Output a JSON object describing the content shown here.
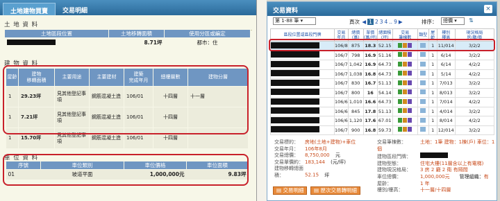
{
  "left_panel": {
    "tabs": [
      "土地建物買賣",
      "交易明細"
    ],
    "land": {
      "title": "土 地 資 料",
      "headers": [
        "土地區段位置",
        "土地移轉面積",
        "使用分區或編定"
      ],
      "row": {
        "area": "8.71坪",
        "zoning": "都市：住"
      }
    },
    "building": {
      "title": "建 物 資 料",
      "headers": [
        "屋齡",
        "建物\n移轉面積",
        "主要用途",
        "主要建材",
        "建築\n完成年月",
        "總樓層數",
        "建物分層"
      ],
      "rows": [
        {
          "age": "1",
          "area": "29.23坪",
          "use": "見其他登記事項",
          "material": "鋼筋混凝土造",
          "completed": "106/01",
          "floors": "十四層",
          "layer": "十一層"
        },
        {
          "age": "1",
          "area": "7.21坪",
          "use": "見其他登記事項",
          "material": "鋼筋混凝土造",
          "completed": "106/01",
          "floors": "十四層",
          "layer": ""
        },
        {
          "age": "1",
          "area": "15.70坪",
          "use": "見其他登記事項",
          "material": "鋼筋混凝土造",
          "completed": "106/01",
          "floors": "十四層",
          "layer": ""
        }
      ]
    },
    "parking": {
      "title": "車 位 資 料",
      "headers": [
        "序號",
        "車位類別",
        "車位價格",
        "車位面積"
      ],
      "row": {
        "no": "01",
        "type": "坡道平面",
        "price": "1,000,000元",
        "area": "9.83坪"
      }
    }
  },
  "right_panel": {
    "title": "交易資料",
    "close": "×",
    "range_select": "第 1-88 筆",
    "pages_label": "頁次",
    "pages": [
      "1",
      "2",
      "3",
      "4",
      "..",
      "9"
    ],
    "sort_label": "排序：",
    "sort_select": "總價",
    "headers": [
      "區段位置或區段門牌",
      "交易\n年月",
      "總價\n(萬)",
      "單價\n(萬/坪)",
      "總面積\n(坪)",
      "交易\n筆棟數",
      "類型",
      "屋齡",
      "樓別\n樓高",
      "現況格局\n房/廳/衛"
    ],
    "rows": [
      {
        "ym": "106/8",
        "total": "875",
        "unit": "18.3",
        "area": "52.15",
        "age": "1",
        "floor": "11/014",
        "layout": "3/2/2"
      },
      {
        "ym": "106/7",
        "total": "798",
        "unit": "16.9",
        "area": "51.16",
        "age": "1",
        "floor": "6/14",
        "layout": "3/2/2"
      },
      {
        "ym": "106/7",
        "total": "1,042",
        "unit": "16.9",
        "area": "64.73",
        "age": "1",
        "floor": "6/14",
        "layout": "4/2/2"
      },
      {
        "ym": "106/7",
        "total": "1,038",
        "unit": "16.8",
        "area": "64.73",
        "age": "1",
        "floor": "5/14",
        "layout": "4/2/2"
      },
      {
        "ym": "106/7",
        "total": "830",
        "unit": "16.7",
        "area": "51.13",
        "age": "1",
        "floor": "7/013",
        "layout": "3/2/2"
      },
      {
        "ym": "106/7",
        "total": "800",
        "unit": "16",
        "area": "54.14",
        "age": "1",
        "floor": "8/013",
        "layout": "3/2/2"
      },
      {
        "ym": "106/6",
        "total": "1,010",
        "unit": "16.6",
        "area": "64.73",
        "age": "1",
        "floor": "7/014",
        "layout": "4/2/2"
      },
      {
        "ym": "106/6",
        "total": "845",
        "unit": "17.8",
        "area": "51.13",
        "age": "1",
        "floor": "4/014",
        "layout": "3/2/2"
      },
      {
        "ym": "106/6",
        "total": "1,120",
        "unit": "17.6",
        "area": "67.01",
        "age": "1",
        "floor": "8/014",
        "layout": "4/2/2"
      },
      {
        "ym": "106/7",
        "total": "900",
        "unit": "16.8",
        "area": "59.73",
        "age": "1",
        "floor": "12/014",
        "layout": "3/2/2"
      }
    ],
    "detail": {
      "left": [
        {
          "k": "交易標的：",
          "v": "房地(土地+建物)+車位"
        },
        {
          "k": "交易年月：",
          "v": "106年8月"
        },
        {
          "k": "交易總價：",
          "v": "8,750,000",
          "u": "元"
        },
        {
          "k": "交易單價約：",
          "v": "183,144",
          "u": "(元/坪)"
        },
        {
          "k": "建物移轉總面積：",
          "v": "52.15",
          "u": "坪"
        }
      ],
      "right": [
        {
          "k": "交易筆棟數：",
          "v": "土地：1筆 建物：1棟(戶) 車位：1個"
        },
        {
          "k": "建物區段門牌：",
          "v": ""
        },
        {
          "k": "建物型態：",
          "v": "住宅大樓(11層含以上有電梯)"
        },
        {
          "k": "建物現況格局：",
          "v": "3 房 2 廳 2 衛 有隔間"
        },
        {
          "k": "車位總價：",
          "v": "1,000,000元",
          "extra_k": "管理組織：",
          "extra_v": "有"
        },
        {
          "k": "屋齡：",
          "v": "1 年"
        },
        {
          "k": "樓別/樓高：",
          "v": "十一層/十四層"
        }
      ]
    },
    "buttons": {
      "detail": "交易明細",
      "history": "歷次交易轉明細"
    }
  }
}
